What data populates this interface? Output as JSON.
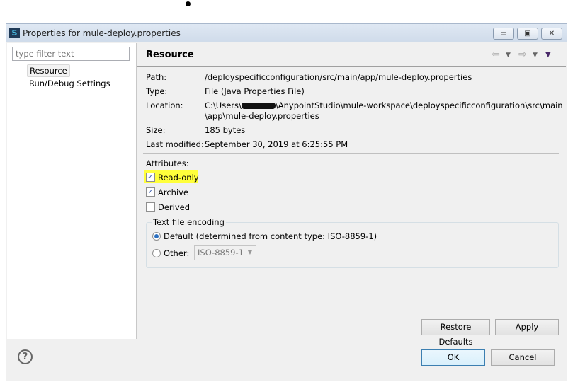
{
  "window": {
    "title": "Properties for mule-deploy.properties",
    "minimize": "▭",
    "maximize": "▣",
    "close": "✕"
  },
  "sidebar": {
    "filter_placeholder": "type filter text",
    "items": [
      {
        "label": "Resource",
        "selected": true
      },
      {
        "label": "Run/Debug Settings"
      }
    ]
  },
  "resource": {
    "title": "Resource",
    "path_label": "Path:",
    "path": "/deployspecificconfiguration/src/main/app/mule-deploy.properties",
    "type_label": "Type:",
    "type": "File  (Java Properties File)",
    "location_label": "Location:",
    "location_prefix": "C:\\Users\\",
    "location_rest": "\\AnypointStudio\\mule-workspace\\deployspecificconfiguration\\src\\main",
    "location_line2": "\\app\\mule-deploy.properties",
    "size_label": "Size:",
    "size": "185  bytes",
    "modified_label": "Last modified:",
    "modified": "September 30, 2019 at 6:25:55 PM",
    "attributes_label": "Attributes:",
    "attributes": [
      {
        "label": "Read-only",
        "checked": true
      },
      {
        "label": "Archive",
        "checked": true
      },
      {
        "label": "Derived",
        "checked": false
      }
    ],
    "encoding": {
      "title": "Text file encoding",
      "default_label": "Default (determined from content type: ISO-8859-1)",
      "other_label": "Other:",
      "other_value": "ISO-8859-1",
      "selected": "default"
    }
  },
  "buttons": {
    "restore": "Restore Defaults",
    "apply": "Apply",
    "ok": "OK",
    "cancel": "Cancel",
    "help": "?"
  },
  "colors": {
    "highlight": "#ffff3b",
    "accent": "#3c7fb1"
  }
}
